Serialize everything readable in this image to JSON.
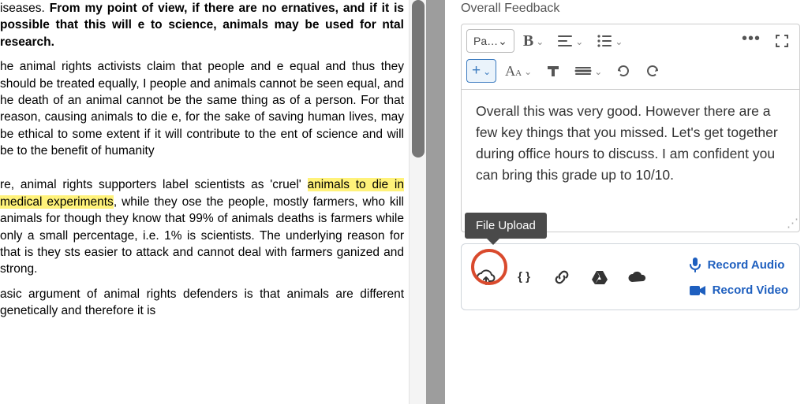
{
  "document": {
    "p1_prefix": "iseases. ",
    "p1_bold": "From my point of view, if there are no ernatives, and if it is possible that this will e to science, animals may be used for ntal research.",
    "p2": "he animal rights activists claim that people and e equal and thus they should be treated equally, I people and animals cannot be seen equal, and he death of an animal cannot be the same thing as of a person. For that reason, causing animals to die e, for the sake of saving human lives, may be ethical to some extent if it will contribute to the ent of science and will be to the benefit of humanity",
    "p3_a": "re, animal rights supporters label scientists as 'cruel' ",
    "p3_hl": "animals to die in medical experiments",
    "p3_b": ", while they ose the people, mostly farmers, who kill animals for though they know that 99% of animals deaths is farmers while only a small percentage, i.e. 1% is scientists. The underlying reason for that is they sts easier to attack and cannot deal with farmers ganized and strong.",
    "p4": "asic argument of animal rights defenders is that animals are different genetically and therefore it is"
  },
  "feedback": {
    "title": "Overall Feedback",
    "toolbar": {
      "para_label": "Pa…",
      "more": "•••"
    },
    "body": "Overall this was very good. However there are a few key things that you missed. Let's get together during office hours to discuss. I am confident you can bring this grade up to 10/10."
  },
  "attach": {
    "tooltip": "File Upload",
    "record_audio": "Record Audio",
    "record_video": "Record Video"
  }
}
